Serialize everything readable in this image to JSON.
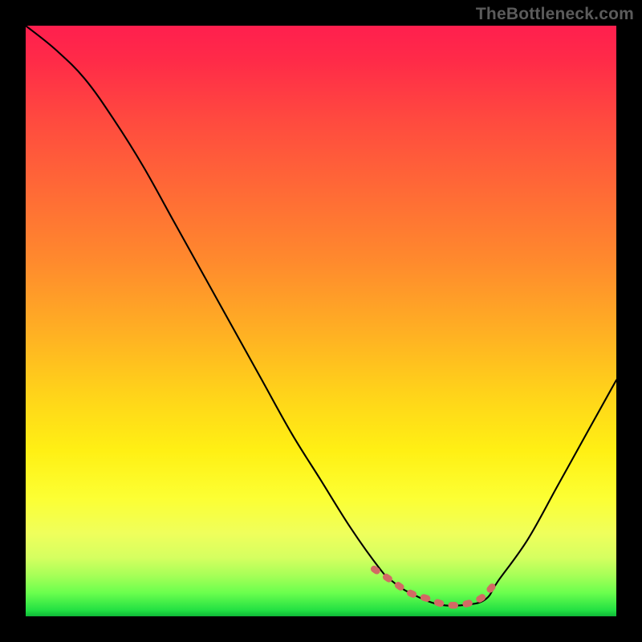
{
  "watermark": {
    "text": "TheBottleneck.com"
  },
  "colors": {
    "background": "#000000",
    "watermark": "#5b5b5b",
    "curve": "#000000",
    "basin_dots": "#d26a64",
    "gradient_top": "#ff1f4e",
    "gradient_mid1": "#ff8a2d",
    "gradient_mid2": "#fff014",
    "gradient_bottom": "#22e043"
  },
  "chart_data": {
    "type": "line",
    "title": "",
    "xlabel": "",
    "ylabel": "",
    "xlim": [
      0,
      100
    ],
    "ylim": [
      0,
      100
    ],
    "grid": false,
    "legend": false,
    "annotations": [],
    "series": [
      {
        "name": "bottleneck-curve",
        "comment": "x is horizontal position 0-100, y is vertical position 0 (bottom/green) to 100 (top/red). Values estimated from pixels.",
        "x": [
          0,
          5,
          10,
          15,
          20,
          25,
          30,
          35,
          40,
          45,
          50,
          55,
          60,
          62,
          65,
          70,
          75,
          78,
          80,
          85,
          90,
          95,
          100
        ],
        "y": [
          100,
          96,
          91,
          84,
          76,
          67,
          58,
          49,
          40,
          31,
          23,
          15,
          8,
          6,
          4,
          2,
          2,
          3,
          6,
          13,
          22,
          31,
          40
        ]
      },
      {
        "name": "optimal-basin-dots",
        "comment": "dotted segment along the bottom valley of the curve",
        "x": [
          59,
          62,
          65,
          68,
          71,
          74,
          77,
          79
        ],
        "y": [
          8,
          6,
          4,
          3,
          2,
          2,
          3,
          5
        ]
      }
    ]
  }
}
